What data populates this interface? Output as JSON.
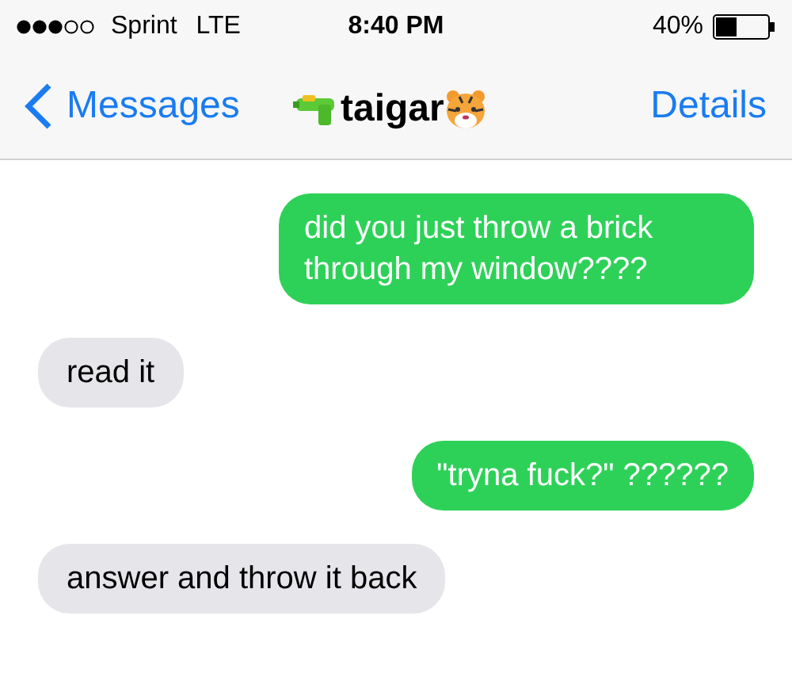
{
  "status_bar": {
    "carrier": "Sprint",
    "network": "LTE",
    "time": "8:40 PM",
    "battery": "40%"
  },
  "nav_bar": {
    "back": "Messages",
    "title": "taigar",
    "action": "Details"
  },
  "messages": [
    {
      "kind": "sent",
      "text": "did you just throw a brick through my window????"
    },
    {
      "kind": "received",
      "text": "read it"
    },
    {
      "kind": "sent",
      "text": "\"tryna fuck?\" ??????"
    },
    {
      "kind": "received",
      "text": "answer and throw it back"
    }
  ]
}
